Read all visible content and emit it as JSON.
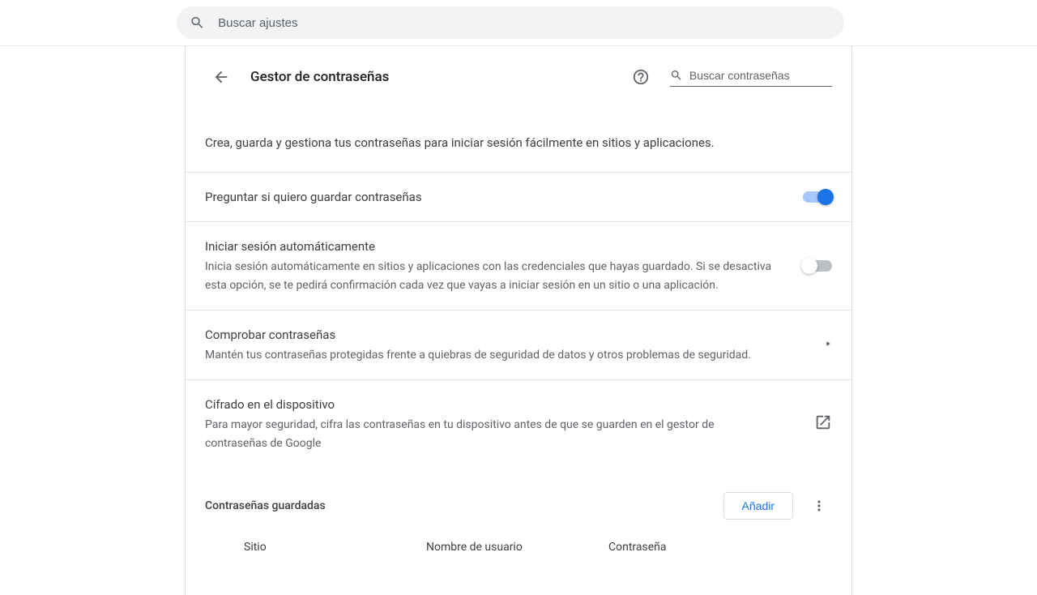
{
  "top_search_placeholder": "Buscar ajustes",
  "header": {
    "title": "Gestor de contraseñas",
    "search_placeholder": "Buscar contraseñas"
  },
  "intro": "Crea, guarda y gestiona tus contraseñas para iniciar sesión fácilmente en sitios y aplicaciones.",
  "rows": {
    "ask_save": {
      "title": "Preguntar si quiero guardar contraseñas",
      "on": true
    },
    "auto_signin": {
      "title": "Iniciar sesión automáticamente",
      "desc": "Inicia sesión automáticamente en sitios y aplicaciones con las credenciales que hayas guardado. Si se desactiva esta opción, se te pedirá confirmación cada vez que vayas a iniciar sesión en un sitio o una aplicación.",
      "on": false
    },
    "check_pw": {
      "title": "Comprobar contraseñas",
      "desc": "Mantén tus contraseñas protegidas frente a quiebras de seguridad de datos y otros problemas de seguridad."
    },
    "encryption": {
      "title": "Cifrado en el dispositivo",
      "desc": "Para mayor seguridad, cifra las contraseñas en tu dispositivo antes de que se guarden en el gestor de contraseñas de Google"
    }
  },
  "saved": {
    "title": "Contraseñas guardadas",
    "add_label": "Añadir",
    "columns": {
      "site": "Sitio",
      "user": "Nombre de usuario",
      "password": "Contraseña"
    }
  }
}
